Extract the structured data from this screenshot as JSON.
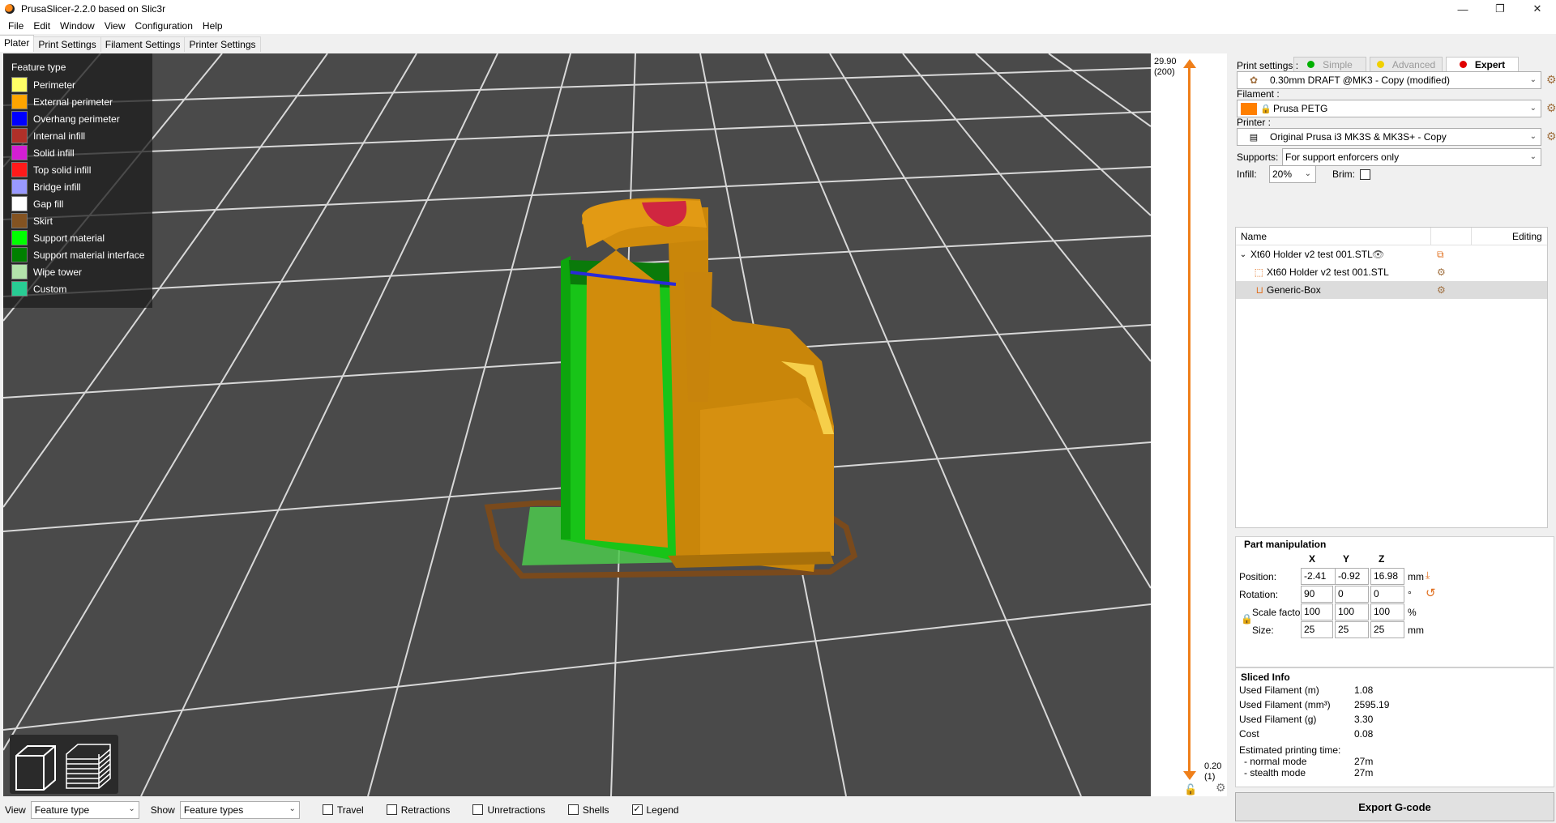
{
  "window": {
    "title": "PrusaSlicer-2.2.0 based on Slic3r",
    "minimize": "—",
    "maximize": "❐",
    "close": "✕"
  },
  "menu": [
    "File",
    "Edit",
    "Window",
    "View",
    "Configuration",
    "Help"
  ],
  "tabs": [
    "Plater",
    "Print Settings",
    "Filament Settings",
    "Printer Settings"
  ],
  "legend": {
    "title": "Feature type",
    "items": [
      {
        "label": "Perimeter",
        "color": "#ffff66"
      },
      {
        "label": "External perimeter",
        "color": "#ffa500"
      },
      {
        "label": "Overhang perimeter",
        "color": "#0000ff"
      },
      {
        "label": "Internal infill",
        "color": "#b03029"
      },
      {
        "label": "Solid infill",
        "color": "#d41ed4"
      },
      {
        "label": "Top solid infill",
        "color": "#ff1a1a"
      },
      {
        "label": "Bridge infill",
        "color": "#9999ff"
      },
      {
        "label": "Gap fill",
        "color": "#ffffff"
      },
      {
        "label": "Skirt",
        "color": "#845321"
      },
      {
        "label": "Support material",
        "color": "#00ff00"
      },
      {
        "label": "Support material interface",
        "color": "#008000"
      },
      {
        "label": "Wipe tower",
        "color": "#b3e3ab"
      },
      {
        "label": "Custom",
        "color": "#28cc94"
      }
    ]
  },
  "layer_slider": {
    "top_value": "29.90",
    "top_layer": "(200)",
    "bottom_value": "0.20",
    "bottom_layer": "(1)"
  },
  "bottom_bar": {
    "view_label": "View",
    "view_value": "Feature type",
    "show_label": "Show",
    "show_value": "Feature types",
    "checks": [
      {
        "label": "Travel",
        "checked": false
      },
      {
        "label": "Retractions",
        "checked": false
      },
      {
        "label": "Unretractions",
        "checked": false
      },
      {
        "label": "Shells",
        "checked": false
      },
      {
        "label": "Legend",
        "checked": true
      }
    ]
  },
  "modes": [
    {
      "label": "Simple",
      "color": "#00b000"
    },
    {
      "label": "Advanced",
      "color": "#f0d000"
    },
    {
      "label": "Expert",
      "color": "#e00000"
    }
  ],
  "settings": {
    "print_label": "Print settings :",
    "print_value": "0.30mm DRAFT @MK3 - Copy (modified)",
    "filament_label": "Filament :",
    "filament_value": "Prusa PETG",
    "filament_color": "#ff7f00",
    "printer_label": "Printer :",
    "printer_value": "Original Prusa i3 MK3S & MK3S+ - Copy",
    "supports_label": "Supports:",
    "supports_value": "For support enforcers only",
    "infill_label": "Infill:",
    "infill_value": "20%",
    "brim_label": "Brim:"
  },
  "object_list": {
    "col_name": "Name",
    "col_editing": "Editing",
    "rows": [
      "Xt60 Holder v2 test 001.STL",
      "Xt60 Holder v2 test 001.STL",
      "Generic-Box"
    ]
  },
  "part_manipulation": {
    "title": "Part manipulation",
    "x": "X",
    "y": "Y",
    "z": "Z",
    "position_label": "Position:",
    "position": [
      "-2.41",
      "-0.92",
      "16.98"
    ],
    "position_unit": "mm",
    "rotation_label": "Rotation:",
    "rotation": [
      "90",
      "0",
      "0"
    ],
    "rotation_unit": "°",
    "scale_label": "Scale factors:",
    "scale": [
      "100",
      "100",
      "100"
    ],
    "scale_unit": "%",
    "size_label": "Size:",
    "size": [
      "25",
      "25",
      "25"
    ],
    "size_unit": "mm"
  },
  "sliced_info": {
    "title": "Sliced Info",
    "rows": [
      {
        "k": "Used Filament (m)",
        "v": "1.08"
      },
      {
        "k": "Used Filament (mm³)",
        "v": "2595.19"
      },
      {
        "k": "Used Filament (g)",
        "v": "3.30"
      },
      {
        "k": "Cost",
        "v": "0.08"
      }
    ],
    "time_label": "Estimated printing time:",
    "normal_label": "- normal mode",
    "normal_value": "27m",
    "stealth_label": "- stealth mode",
    "stealth_value": "27m"
  },
  "export_button": "Export G-code"
}
